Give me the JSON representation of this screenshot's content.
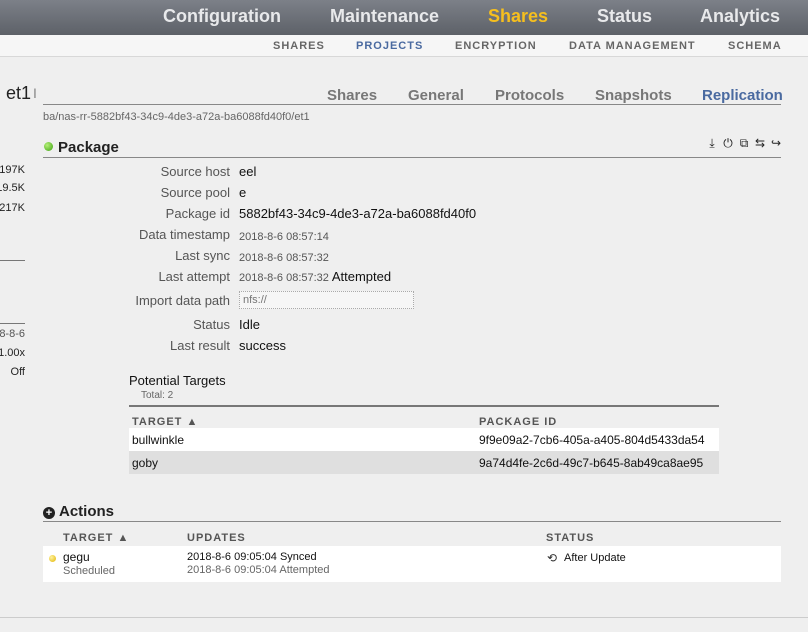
{
  "top_nav": [
    "Configuration",
    "Maintenance",
    "Shares",
    "Status",
    "Analytics"
  ],
  "sub_nav": [
    "SHARES",
    "PROJECTS",
    "ENCRYPTION",
    "DATA MANAGEMENT",
    "SCHEMA"
  ],
  "left_panel": {
    "title": "et1",
    "cursor": "I",
    "values": [
      "197K",
      "19.5K",
      "217K",
      "8-8-6",
      "1.00x",
      "Off"
    ]
  },
  "tabs": [
    "Shares",
    "General",
    "Protocols",
    "Snapshots",
    "Replication"
  ],
  "breadcrumb": "ba/nas-rr-5882bf43-34c9-4de3-a72a-ba6088fd40f0/et1",
  "package": {
    "title": "Package",
    "toolbar_icons": [
      "download-icon",
      "power-icon",
      "clone-icon",
      "reverse-icon",
      "sever-icon"
    ],
    "props": {
      "source_host": {
        "label": "Source host",
        "value": "eel"
      },
      "source_pool": {
        "label": "Source pool",
        "value": "e"
      },
      "package_id": {
        "label": "Package id",
        "value": "5882bf43-34c9-4de3-a72a-ba6088fd40f0"
      },
      "data_timestamp": {
        "label": "Data timestamp",
        "value": "2018-8-6 08:57:14"
      },
      "last_sync": {
        "label": "Last sync",
        "value": "2018-8-6 08:57:32"
      },
      "last_attempt": {
        "label": "Last attempt",
        "value": "2018-8-6 08:57:32",
        "status": "Attempted"
      },
      "import_path": {
        "label": "Import data path",
        "placeholder": "nfs://"
      },
      "status": {
        "label": "Status",
        "value": "Idle"
      },
      "last_result": {
        "label": "Last result",
        "value": "success"
      }
    }
  },
  "potential_targets": {
    "title": "Potential Targets",
    "total": "Total: 2",
    "headers": {
      "target": "TARGET ▲",
      "package_id": "PACKAGE ID"
    },
    "rows": [
      {
        "target": "bullwinkle",
        "package_id": "9f9e09a2-7cb6-405a-a405-804d5433da54"
      },
      {
        "target": "goby",
        "package_id": "9a74d4fe-2c6d-49c7-b645-8ab49ca8ae95"
      }
    ]
  },
  "actions": {
    "title": "Actions",
    "headers": {
      "target": "TARGET ▲",
      "updates": "UPDATES",
      "status": "STATUS"
    },
    "row": {
      "target": "gegu",
      "target_sub": "Scheduled",
      "update1": "2018-8-6 09:05:04 Synced",
      "update2": "2018-8-6 09:05:04 Attempted",
      "status": "After Update"
    }
  },
  "colors": {
    "active_nav": "#f6bf1e",
    "active_tab": "#4a6aa0"
  }
}
